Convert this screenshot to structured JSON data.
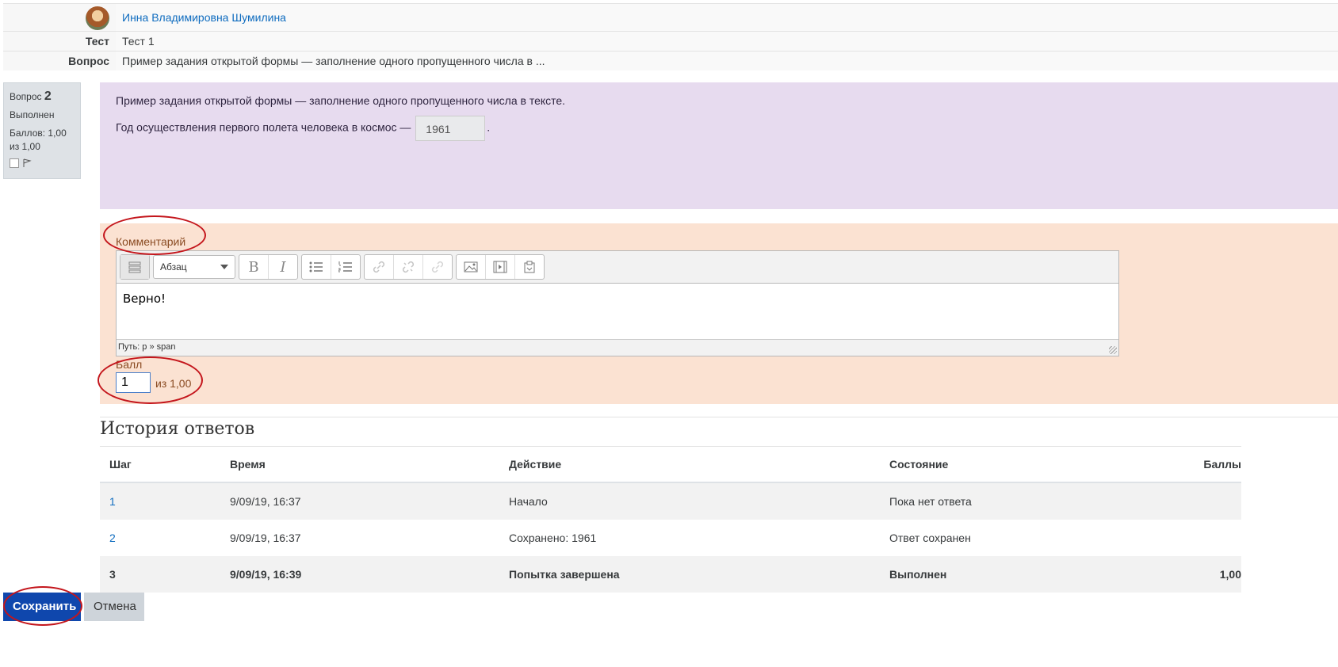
{
  "info": {
    "user_name": "Инна Владимировна Шумилина",
    "quiz_label": "Тест",
    "quiz_value": "Тест 1",
    "question_label": "Вопрос",
    "question_value": "Пример задания открытой формы — заполнение одного пропущенного числа в ..."
  },
  "qinfo": {
    "question_word": "Вопрос",
    "question_number": "2",
    "state": "Выполнен",
    "marks": "Баллов: 1,00 из 1,00"
  },
  "question": {
    "text1": "Пример задания открытой формы — заполнение одного пропущенного числа в тексте.",
    "text2": "Год осуществления первого полета человека в космос —",
    "answer": "1961",
    "text_end": "."
  },
  "comment": {
    "label": "Комментарий",
    "format": "Абзац",
    "content": "Верно!",
    "path": "Путь: p » span",
    "grade_label": "Балл",
    "grade_value": "1",
    "grade_max": "из 1,00"
  },
  "history": {
    "title": "История ответов",
    "headers": [
      "Шаг",
      "Время",
      "Действие",
      "Состояние",
      "Баллы"
    ],
    "rows": [
      {
        "step": "1",
        "time": "9/09/19, 16:37",
        "action": "Начало",
        "state": "Пока нет ответа",
        "grade": ""
      },
      {
        "step": "2",
        "time": "9/09/19, 16:37",
        "action": "Сохранено: 1961",
        "state": "Ответ сохранен",
        "grade": ""
      },
      {
        "step": "3",
        "time": "9/09/19, 16:39",
        "action": "Попытка завершена",
        "state": "Выполнен",
        "grade": "1,00"
      }
    ]
  },
  "buttons": {
    "save": "Сохранить",
    "cancel": "Отмена"
  },
  "colors": {
    "link": "#0f6cbf",
    "question_bg": "#e7dbef",
    "comment_bg": "#fbe2d2",
    "save_bg": "#0f47ad",
    "annotation": "#c4161c"
  }
}
